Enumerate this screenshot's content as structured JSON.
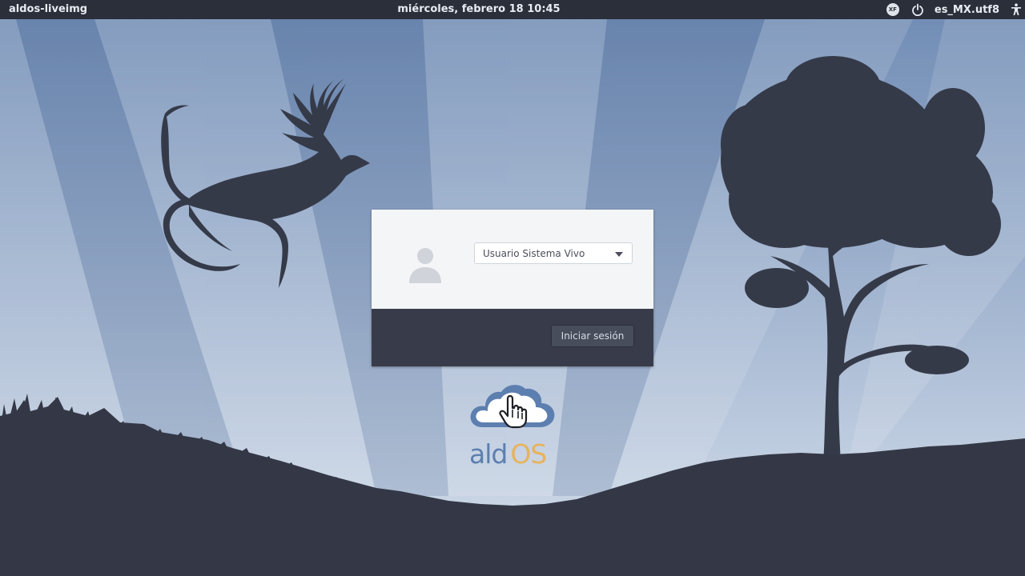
{
  "topbar": {
    "hostname": "aldos-liveimg",
    "datetime": "miércoles, febrero 18  10:45",
    "keyboard_badge": "XF",
    "locale": "es_MX.utf8",
    "icons": [
      "xf-keyboard-icon",
      "power-icon",
      "accessibility-icon"
    ]
  },
  "login": {
    "selected_user": "Usuario Sistema Vivo",
    "login_button": "Iniciar sesión"
  },
  "logo": {
    "part1": "ald",
    "part2": "OS"
  },
  "colors": {
    "panel": "#2b2f3a",
    "card_top": "#f4f5f7",
    "card_bottom": "#383c4a",
    "logo_blue": "#5c7fb0",
    "logo_orange": "#e7b35a"
  }
}
